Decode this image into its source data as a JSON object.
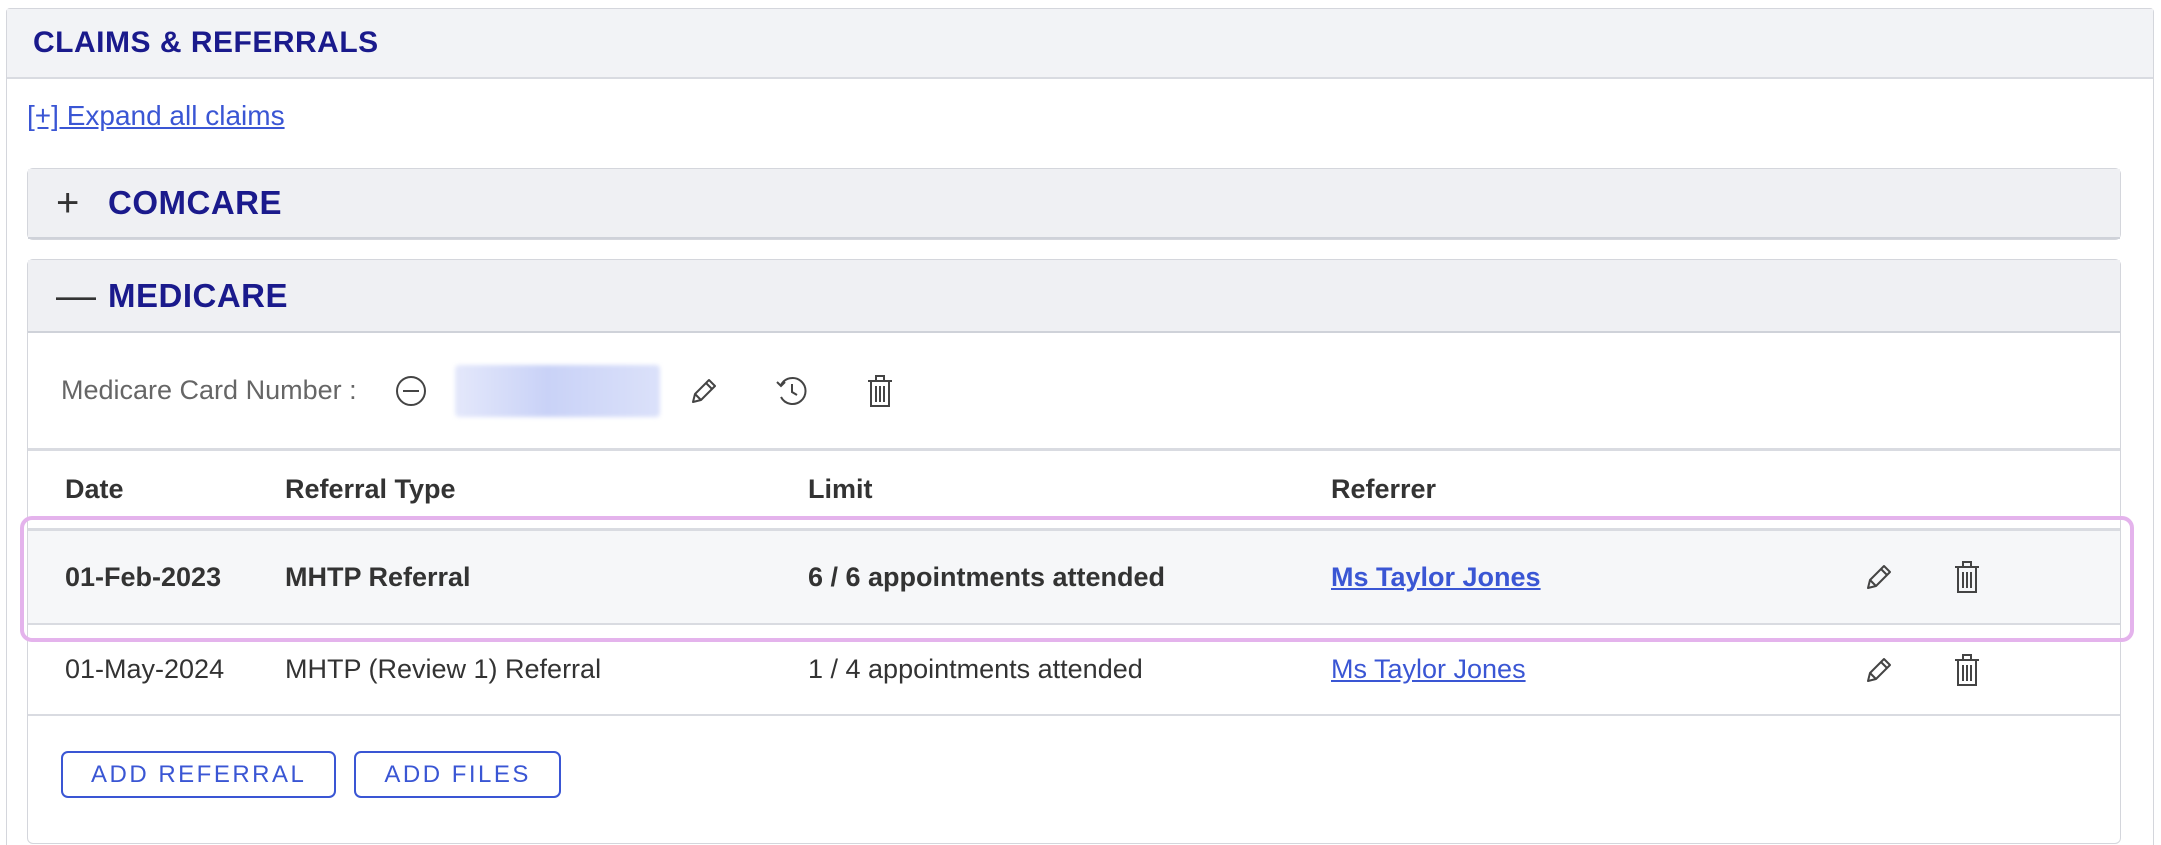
{
  "panel": {
    "title": "CLAIMS & REFERRALS"
  },
  "expand_link": "[+] Expand all claims",
  "comcare": {
    "toggle": "+",
    "title": "COMCARE"
  },
  "medicare": {
    "toggle": "—",
    "title": "MEDICARE",
    "card_label": "Medicare Card Number :",
    "icons": [
      "minus-circle-icon",
      "pencil-icon",
      "history-icon",
      "trash-icon"
    ]
  },
  "table": {
    "headers": {
      "date": "Date",
      "type": "Referral Type",
      "limit": "Limit",
      "referrer": "Referrer"
    },
    "rows": [
      {
        "date": "01-Feb-2023",
        "type": "MHTP Referral",
        "limit": "6 / 6 appointments attended",
        "referrer": "Ms Taylor Jones"
      },
      {
        "date": "01-May-2024",
        "type": "MHTP (Review 1) Referral",
        "limit": "1 / 4 appointments attended",
        "referrer": "Ms Taylor Jones"
      }
    ]
  },
  "buttons": {
    "add_referral": "ADD REFERRAL",
    "add_files": "ADD FILES"
  },
  "colors": {
    "accent": "#3a56d4",
    "title": "#1a1a8c",
    "highlight": "#e4b3ec"
  }
}
